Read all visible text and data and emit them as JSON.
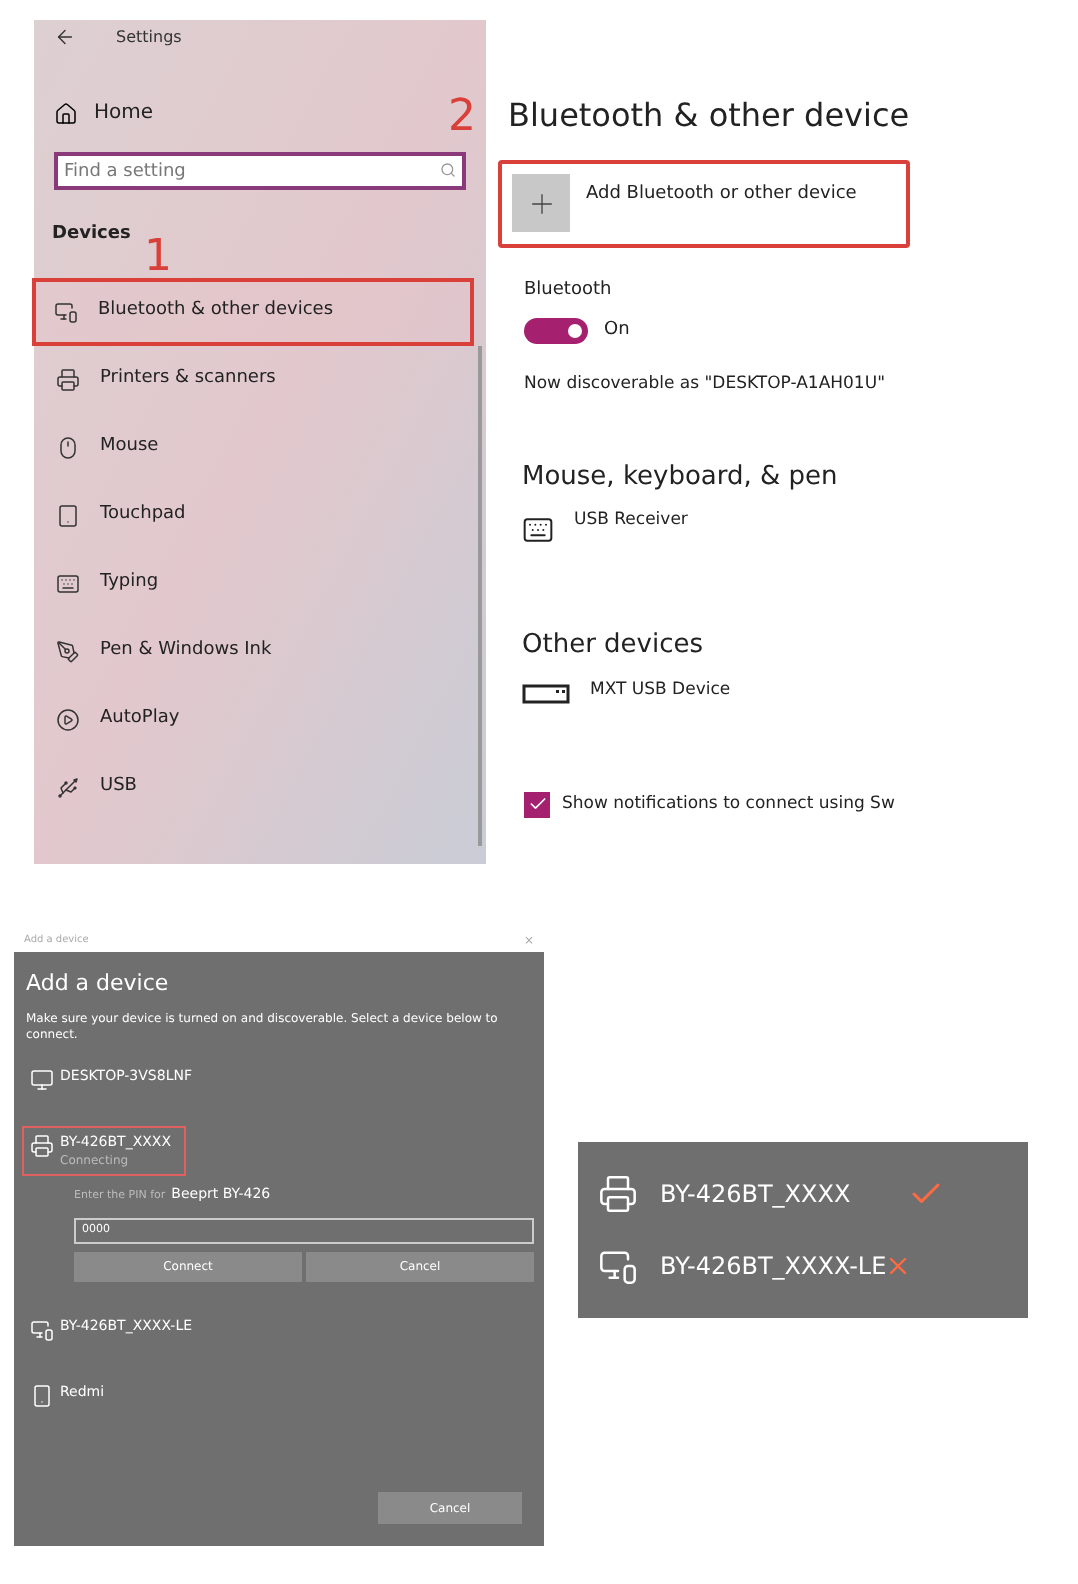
{
  "settings": {
    "title": "Settings",
    "home": "Home",
    "search": {
      "placeholder": "Find a setting"
    },
    "section": "Devices",
    "items": [
      {
        "label": "Bluetooth & other devices",
        "kind": "devices",
        "selected": true
      },
      {
        "label": "Printers & scanners",
        "kind": "printer",
        "selected": false
      },
      {
        "label": "Mouse",
        "kind": "mouse",
        "selected": false
      },
      {
        "label": "Touchpad",
        "kind": "touchpad",
        "selected": false
      },
      {
        "label": "Typing",
        "kind": "keyboard",
        "selected": false
      },
      {
        "label": "Pen & Windows Ink",
        "kind": "pen",
        "selected": false
      },
      {
        "label": "AutoPlay",
        "kind": "autoplay",
        "selected": false
      },
      {
        "label": "USB",
        "kind": "usb",
        "selected": false
      }
    ]
  },
  "steps": [
    "1",
    "2"
  ],
  "bluetooth_page": {
    "title": "Bluetooth & other device",
    "add_button": "Add Bluetooth or other device",
    "toggle_label": "Bluetooth",
    "toggle": {
      "on": true,
      "state": "On"
    },
    "discoverable": "Now discoverable as \"DESKTOP-A1AH01U\"",
    "sections": [
      {
        "heading": "Mouse, keyboard, & pen",
        "device": "USB Receiver",
        "kind": "keyboard"
      },
      {
        "heading": "Other devices",
        "device": "MXT USB Device",
        "kind": "dongle"
      }
    ],
    "notifications": {
      "checked": true,
      "label": "Show notifications to connect using Sw"
    }
  },
  "dialog": {
    "title": "Add a device",
    "close": "×",
    "heading": "Add a device",
    "description": "Make sure your device is turned on and discoverable. Select a device below to connect.",
    "devices": [
      {
        "name": "DESKTOP-3VS8LNF",
        "kind": "computer",
        "selected": false
      },
      {
        "name": "BY-426BT_XXXX",
        "kind": "printer",
        "selected": true,
        "status": "Connecting",
        "pin_prompt": "Enter the PIN for",
        "pin_device": "Beeprt BY-426",
        "pin": "0000",
        "buttons": [
          "Connect",
          "Cancel"
        ]
      },
      {
        "name": "BY-426BT_XXXX-LE",
        "kind": "devices",
        "selected": false
      },
      {
        "name": "Redmi",
        "kind": "phone",
        "selected": false
      }
    ],
    "cancel": "Cancel"
  },
  "legend": [
    {
      "name": "BY-426BT_XXXX",
      "kind": "printer",
      "connected": true
    },
    {
      "name": "BY-426BT_XXXX-LE",
      "kind": "devices",
      "connected": false
    }
  ]
}
